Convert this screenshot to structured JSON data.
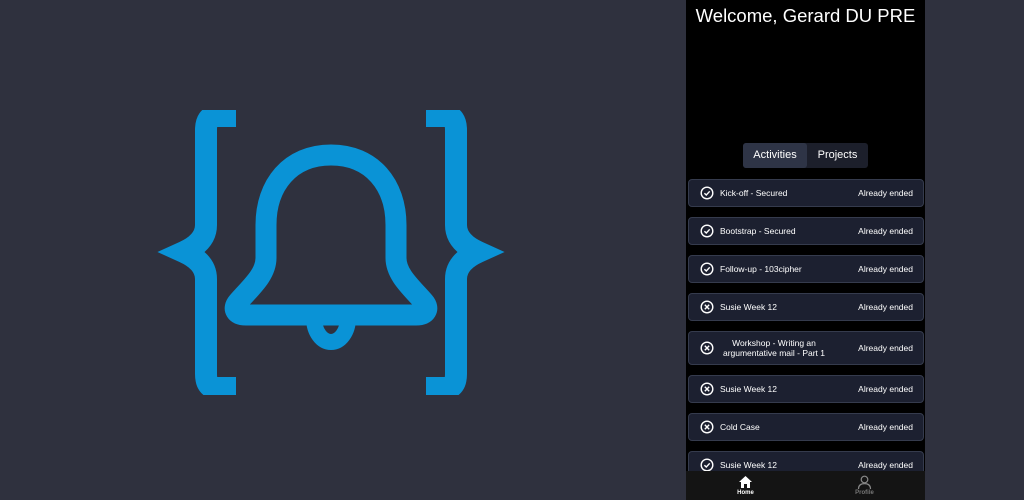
{
  "welcome": "Welcome, Gerard DU PRE",
  "tabs": [
    {
      "label": "Activities",
      "active": true
    },
    {
      "label": "Projects",
      "active": false
    }
  ],
  "activities": [
    {
      "name": "Kick-off - Secured",
      "status": "Already ended",
      "icon": "check-circle-icon"
    },
    {
      "name": "Bootstrap - Secured",
      "status": "Already ended",
      "icon": "check-circle-icon"
    },
    {
      "name": "Follow-up - 103cipher",
      "status": "Already ended",
      "icon": "check-circle-icon"
    },
    {
      "name": "Susie Week 12",
      "status": "Already ended",
      "icon": "x-circle-icon"
    },
    {
      "name": "Workshop - Writing an argumentative mail - Part 1",
      "status": "Already ended",
      "icon": "x-circle-icon"
    },
    {
      "name": "Susie Week 12",
      "status": "Already ended",
      "icon": "x-circle-icon"
    },
    {
      "name": "Cold Case",
      "status": "Already ended",
      "icon": "x-circle-icon"
    },
    {
      "name": "Susie Week 12",
      "status": "Already ended",
      "icon": "check-circle-icon"
    }
  ],
  "nav": {
    "home": {
      "label": "Home",
      "icon": "home-icon"
    },
    "profile": {
      "label": "Profile",
      "icon": "person-icon"
    }
  },
  "colors": {
    "background": "#2f313e",
    "logo": "#0a93d6",
    "card": "#1c2030"
  }
}
